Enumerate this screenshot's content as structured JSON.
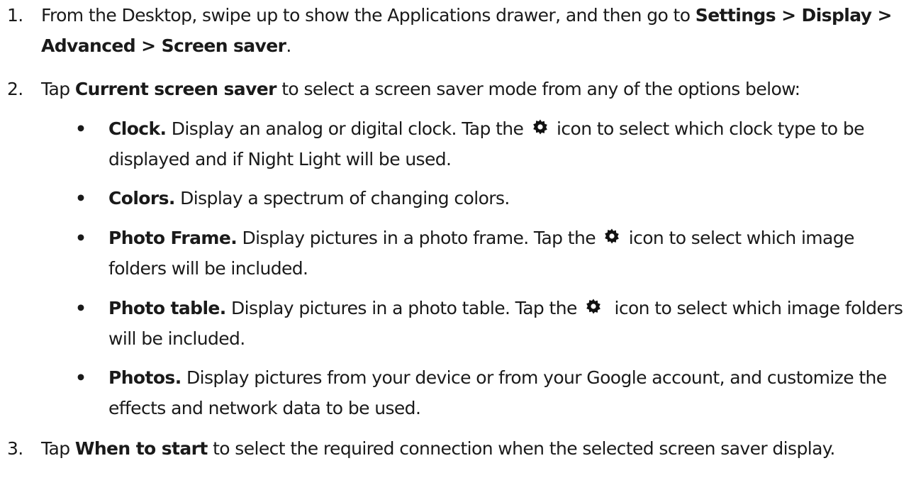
{
  "steps": [
    {
      "number": "1.",
      "text_1": "From the Desktop, swipe up to show the Applications drawer, and then go to ",
      "bold_1": "Settings > Display > Advanced > Screen saver",
      "text_2": "."
    },
    {
      "number": "2.",
      "text_1": "Tap ",
      "bold_1": "Current screen saver",
      "text_2": " to select a screen saver mode from any of the options below:"
    },
    {
      "number": "3.",
      "text_1": "Tap ",
      "bold_1": "When to start",
      "text_2": " to select the required connection when the selected screen saver display."
    }
  ],
  "bullet_symbol": "•",
  "options": [
    {
      "title": "Clock.",
      "text_before_icon": " Display an analog or digital clock. Tap the ",
      "icon": "gear-icon",
      "text_after_icon": " icon to select which clock type to be displayed and if Night Light will be used."
    },
    {
      "title": "Colors.",
      "text": " Display a spectrum of changing colors."
    },
    {
      "title": "Photo Frame.",
      "text_before_icon": " Display pictures in a photo frame. Tap the ",
      "icon": "gear-icon",
      "text_after_icon": " icon to select which image folders will be included."
    },
    {
      "title": "Photo table.",
      "text_before_icon": " Display pictures in a photo table. Tap the ",
      "icon": "gear-icon",
      "text_after_icon": " icon to select which image folders will be included."
    },
    {
      "title": "Photos.",
      "text": " Display pictures from your device or from your Google account, and customize the effects and network data to be used."
    }
  ],
  "colors": {
    "text": "#1a1a1a",
    "background": "#ffffff"
  }
}
